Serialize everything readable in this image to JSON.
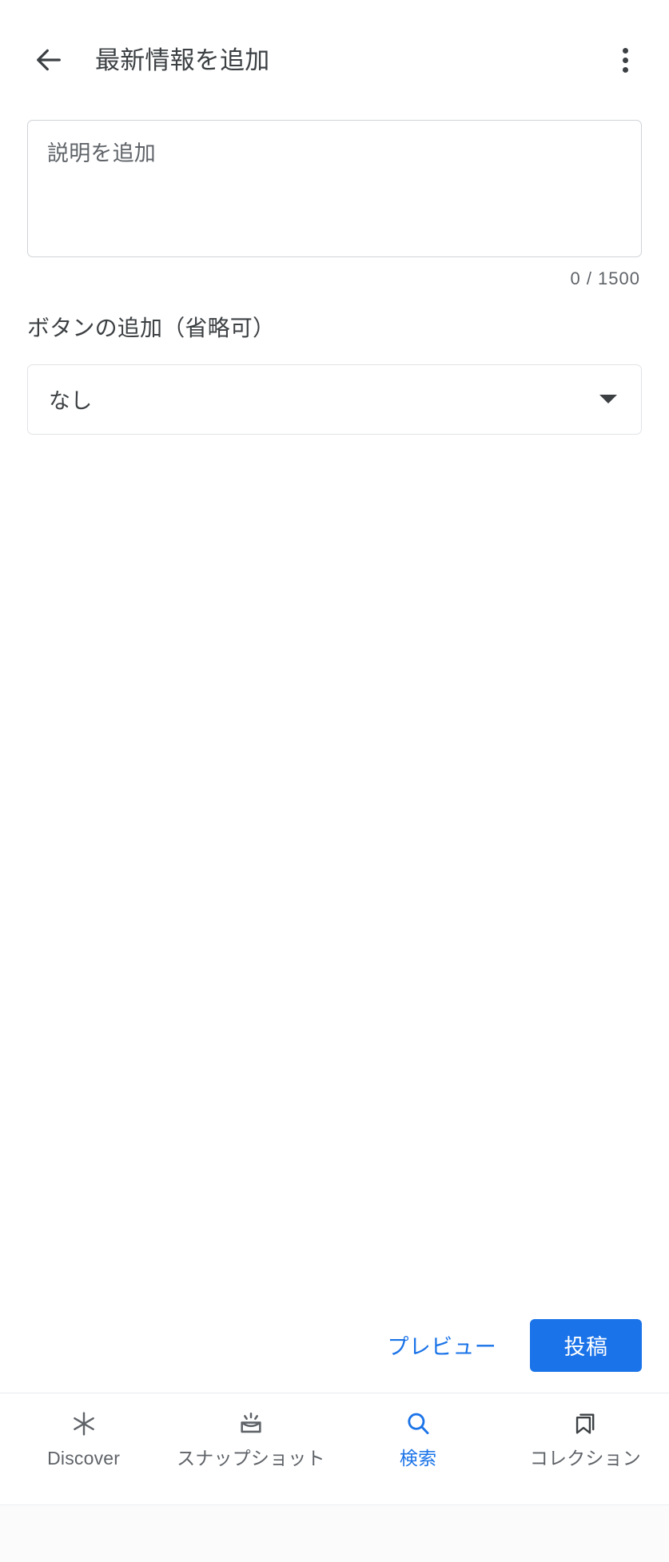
{
  "appbar": {
    "back_icon": "arrow-back-icon",
    "title": "最新情報を追加",
    "overflow_icon": "more-vert-icon"
  },
  "form": {
    "description": {
      "value": "",
      "placeholder": "説明を追加",
      "counter": "0 / 1500",
      "max_length": 1500,
      "current_length": 0
    },
    "button_section": {
      "label": "ボタンの追加（省略可）",
      "select_value": "なし",
      "select_arrow_icon": "dropdown-arrow-icon"
    }
  },
  "actions": {
    "preview_label": "プレビュー",
    "post_label": "投稿"
  },
  "bottom_nav": {
    "items": [
      {
        "label": "Discover",
        "icon": "asterisk-icon",
        "active": false
      },
      {
        "label": "スナップショット",
        "icon": "snapshot-icon",
        "active": false
      },
      {
        "label": "検索",
        "icon": "search-icon",
        "active": true
      },
      {
        "label": "コレクション",
        "icon": "bookmark-icon",
        "active": false
      }
    ]
  },
  "colors": {
    "accent": "#1a73e8",
    "text_primary": "#3c4043",
    "text_secondary": "#5f6368",
    "border": "#cfd3d7",
    "background": "#ffffff"
  }
}
